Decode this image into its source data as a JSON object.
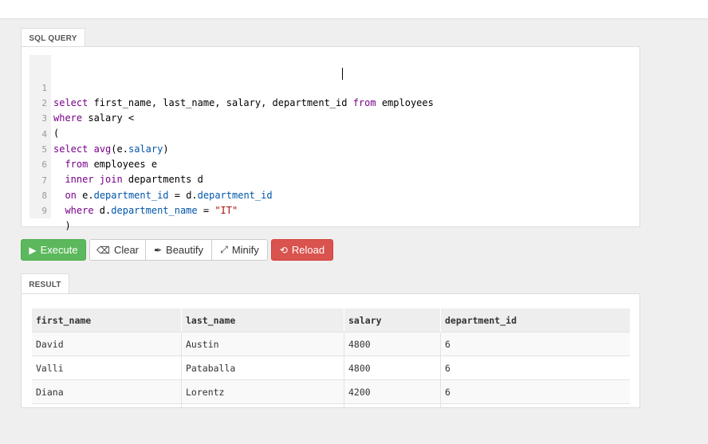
{
  "sql_section": {
    "tab_label": "SQL QUERY",
    "code_lines": [
      {
        "n": "1"
      },
      {
        "n": "2"
      },
      {
        "n": "3"
      },
      {
        "n": "4"
      },
      {
        "n": "5"
      },
      {
        "n": "6"
      },
      {
        "n": "7"
      },
      {
        "n": "8"
      },
      {
        "n": "9"
      }
    ],
    "code_text": [
      "select first_name, last_name, salary, department_id from employees",
      "where salary <",
      "(",
      "select avg(e.salary)",
      "  from employees e",
      "  inner join departments d",
      "  on e.department_id = d.department_id",
      "  where d.department_name = \"IT\"",
      "  )"
    ]
  },
  "toolbar": {
    "execute_label": "Execute",
    "clear_label": "Clear",
    "beautify_label": "Beautify",
    "minify_label": "Minify",
    "reload_label": "Reload"
  },
  "result_section": {
    "tab_label": "RESULT",
    "columns": [
      "first_name",
      "last_name",
      "salary",
      "department_id"
    ],
    "rows": [
      [
        "David",
        "Austin",
        "4800",
        "6"
      ],
      [
        "Valli",
        "Pataballa",
        "4800",
        "6"
      ],
      [
        "Diana",
        "Lorentz",
        "4200",
        "6"
      ],
      [
        "",
        "",
        "",
        ""
      ]
    ]
  },
  "colors": {
    "execute": "#5cb85c",
    "reload": "#d9534f",
    "keyword": "#770088",
    "property": "#0055aa",
    "string": "#aa1111"
  }
}
